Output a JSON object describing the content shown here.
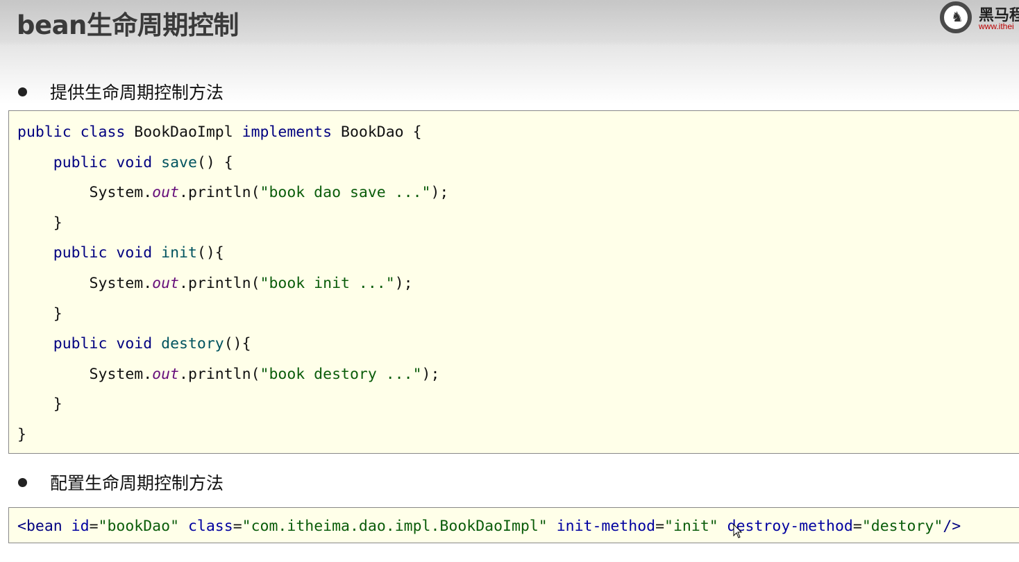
{
  "title": "bean生命周期控制",
  "logo": {
    "name": "黑马程",
    "url": "www.ithei"
  },
  "bullets": [
    "提供生命周期控制方法",
    "配置生命周期控制方法"
  ],
  "colors": {
    "keyword": "#000080",
    "string": "#0a5c0a",
    "method": "#00535f",
    "field": "#660e7a",
    "code_bg": "#ffffe9"
  },
  "code1": [
    [
      [
        "kw",
        "public class "
      ],
      [
        "plain",
        "BookDaoImpl "
      ],
      [
        "kw",
        "implements "
      ],
      [
        "plain",
        "BookDao {"
      ]
    ],
    [
      [
        "plain",
        "    "
      ],
      [
        "kw",
        "public void "
      ],
      [
        "fn",
        "save"
      ],
      [
        "plain",
        "() {"
      ]
    ],
    [
      [
        "plain",
        "        System."
      ],
      [
        "fld",
        "out"
      ],
      [
        "plain",
        ".println("
      ],
      [
        "str",
        "\"book dao save ...\""
      ],
      [
        "plain",
        ");"
      ]
    ],
    [
      [
        "plain",
        "    }"
      ]
    ],
    [
      [
        "plain",
        "    "
      ],
      [
        "kw",
        "public void "
      ],
      [
        "fn",
        "init"
      ],
      [
        "plain",
        "(){"
      ]
    ],
    [
      [
        "plain",
        "        System."
      ],
      [
        "fld",
        "out"
      ],
      [
        "plain",
        ".println("
      ],
      [
        "str",
        "\"book init ...\""
      ],
      [
        "plain",
        ");"
      ]
    ],
    [
      [
        "plain",
        "    }"
      ]
    ],
    [
      [
        "plain",
        "    "
      ],
      [
        "kw",
        "public void "
      ],
      [
        "fn",
        "destory"
      ],
      [
        "plain",
        "(){"
      ]
    ],
    [
      [
        "plain",
        "        System."
      ],
      [
        "fld",
        "out"
      ],
      [
        "plain",
        ".println("
      ],
      [
        "str",
        "\"book destory ...\""
      ],
      [
        "plain",
        ");"
      ]
    ],
    [
      [
        "plain",
        "    }"
      ]
    ],
    [
      [
        "plain",
        "}"
      ]
    ]
  ],
  "code2": [
    [
      "tag",
      "<bean "
    ],
    [
      "attr",
      "id"
    ],
    [
      "plain",
      "="
    ],
    [
      "str",
      "\"bookDao\" "
    ],
    [
      "attr",
      "class"
    ],
    [
      "plain",
      "="
    ],
    [
      "str",
      "\"com.itheima.dao.impl.BookDaoImpl\" "
    ],
    [
      "attr",
      "init-method"
    ],
    [
      "plain",
      "="
    ],
    [
      "str",
      "\"init\" "
    ],
    [
      "attr",
      "destroy-method"
    ],
    [
      "plain",
      "="
    ],
    [
      "str",
      "\"destory\""
    ],
    [
      "tag",
      "/>"
    ]
  ]
}
